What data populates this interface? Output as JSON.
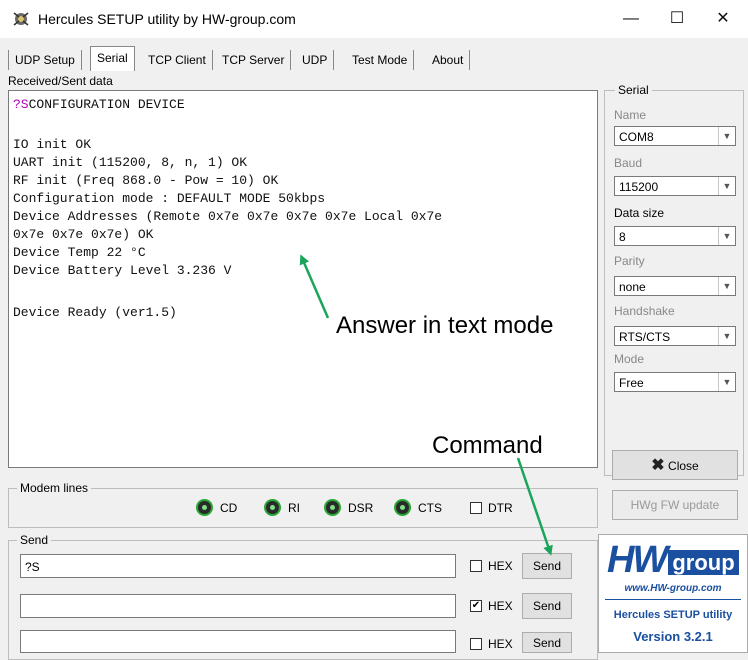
{
  "window": {
    "title": "Hercules SETUP utility by HW-group.com",
    "minimize": "—",
    "maximize": "☐",
    "close": "✕"
  },
  "tabs": [
    {
      "label": "UDP Setup"
    },
    {
      "label": "Serial"
    },
    {
      "label": "TCP Client"
    },
    {
      "label": "TCP Server"
    },
    {
      "label": "UDP"
    },
    {
      "label": "Test Mode"
    },
    {
      "label": "About"
    }
  ],
  "received": {
    "label": "Received/Sent data",
    "first_prefix": "?S",
    "first_rest": "CONFIGURATION DEVICE",
    "lines": [
      "IO init OK",
      "UART init (115200, 8, n, 1) OK",
      "RF init (Freq 868.0 - Pow = 10) OK",
      "Configuration mode : DEFAULT MODE 50kbps",
      "Device Addresses (Remote 0x7e 0x7e 0x7e 0x7e Local 0x7e",
      "0x7e 0x7e 0x7e) OK",
      "Device Temp 22 °C",
      "Device Battery Level 3.236 V",
      "Device Ready (ver1.5)"
    ]
  },
  "serial": {
    "group_title": "Serial",
    "name_label": "Name",
    "name_value": "COM8",
    "baud_label": "Baud",
    "baud_value": "115200",
    "datasize_label": "Data size",
    "datasize_value": "8",
    "parity_label": "Parity",
    "parity_value": "none",
    "handshake_label": "Handshake",
    "handshake_value": "RTS/CTS",
    "mode_label": "Mode",
    "mode_value": "Free",
    "close_label": "Close",
    "fw_label": "HWg FW update"
  },
  "modem": {
    "group_title": "Modem lines",
    "cd": "CD",
    "ri": "RI",
    "dsr": "DSR",
    "cts": "CTS",
    "dtr": "DTR"
  },
  "send": {
    "group_title": "Send",
    "rows": [
      {
        "value": "?S",
        "hex_label": "HEX",
        "hex_checked": false,
        "button": "Send"
      },
      {
        "value": "",
        "hex_label": "HEX",
        "hex_checked": true,
        "button": "Send"
      },
      {
        "value": "",
        "hex_label": "HEX",
        "hex_checked": false,
        "button": "Send"
      }
    ]
  },
  "logo": {
    "brand_hw": "HW",
    "brand_group": "group",
    "url": "www.HW-group.com",
    "product": "Hercules SETUP utility",
    "version": "Version  3.2.1"
  },
  "annotations": {
    "answer": "Answer in text mode",
    "command": "Command"
  },
  "colors": {
    "led": "#26a834",
    "arrow": "#1aa55a",
    "logo_blue": "#1b4fa0",
    "prefix": "#b000b0"
  }
}
